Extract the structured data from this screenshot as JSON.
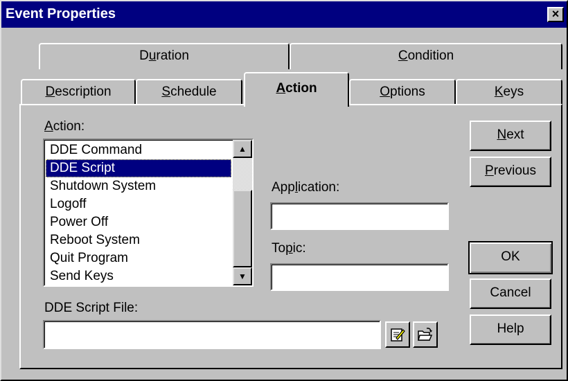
{
  "window": {
    "title": "Event Properties",
    "close_glyph": "×"
  },
  "tabs_row1": [
    {
      "label": "Duration",
      "mnemonic_index": 1
    },
    {
      "label": "Condition",
      "mnemonic_index": 0
    }
  ],
  "tabs_row2": [
    {
      "label": "Description",
      "mnemonic_index": 0
    },
    {
      "label": "Schedule",
      "mnemonic_index": 0
    },
    {
      "label": "Action",
      "mnemonic_index": 0,
      "active": true
    },
    {
      "label": "Options",
      "mnemonic_index": 0
    },
    {
      "label": "Keys",
      "mnemonic_index": 0
    }
  ],
  "action": {
    "label": "Action:",
    "items": [
      "DDE Command",
      "DDE Script",
      "Shutdown System",
      "Logoff",
      "Power Off",
      "Reboot System",
      "Quit Program",
      "Send Keys"
    ],
    "selected": "DDE Script"
  },
  "application": {
    "label": "Application:",
    "value": ""
  },
  "topic": {
    "label": "Topic:",
    "value": ""
  },
  "script_file": {
    "label": "DDE Script File:",
    "value": ""
  },
  "buttons": {
    "next": "Next",
    "previous": "Previous",
    "ok": "OK",
    "cancel": "Cancel",
    "help": "Help"
  },
  "icons": {
    "edit": "edit-file-icon",
    "open": "open-folder-icon"
  },
  "colors": {
    "titlebar": "#000080",
    "face": "#c0c0c0",
    "selection": "#000080"
  }
}
